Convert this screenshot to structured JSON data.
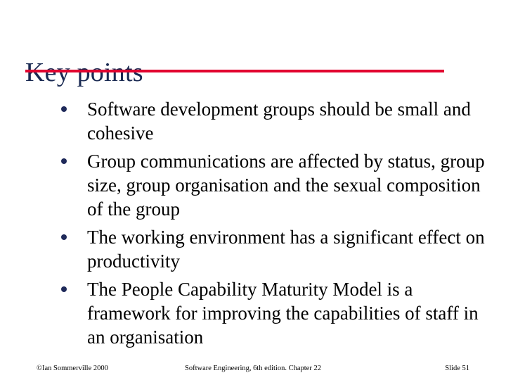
{
  "slide": {
    "title": "Key points",
    "accent_rule_color": "#e2042f",
    "title_color": "#1a2a52",
    "bullet_color": "#1f2a5a",
    "background_color": "#ffffff",
    "bullets": [
      {
        "text": "Software development groups should be small and cohesive"
      },
      {
        "text": "Group communications are affected by status, group size, group organisation and the sexual composition of the group"
      },
      {
        "text": "The working environment has a significant effect on productivity"
      },
      {
        "text": "The People Capability Maturity Model is a framework for improving the capabilities of staff in an organisation"
      }
    ],
    "footer": {
      "left": "©Ian Sommerville 2000",
      "center": "Software Engineering, 6th edition. Chapter 22",
      "right": "Slide 51"
    }
  }
}
